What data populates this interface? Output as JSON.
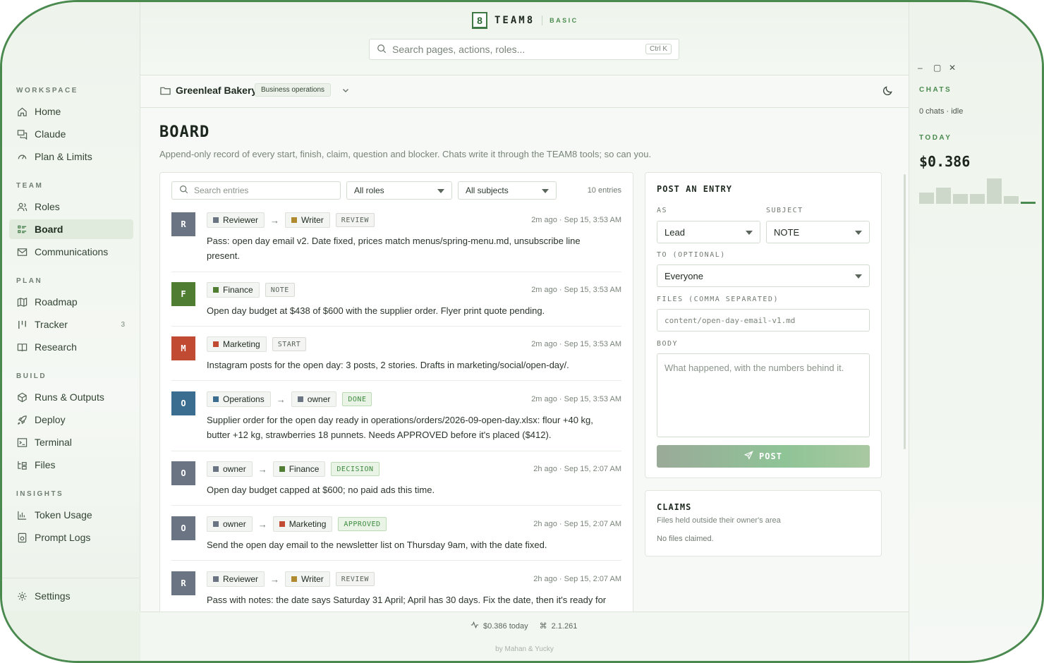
{
  "app": {
    "logo_glyph": "8",
    "name": "TEAM8",
    "plan": "BASIC"
  },
  "search": {
    "placeholder": "Search pages, actions, roles...",
    "shortcut": "Ctrl K"
  },
  "sidebar": {
    "sections": [
      {
        "title": "WORKSPACE"
      },
      {
        "title": "TEAM"
      },
      {
        "title": "PLAN"
      },
      {
        "title": "BUILD"
      },
      {
        "title": "INSIGHTS"
      }
    ],
    "items": [
      {
        "label": "Home",
        "icon": "home-icon"
      },
      {
        "label": "Claude",
        "icon": "chat-icon"
      },
      {
        "label": "Plan & Limits",
        "icon": "gauge-icon"
      },
      {
        "label": "Roles",
        "icon": "users-icon"
      },
      {
        "label": "Board",
        "icon": "board-icon",
        "active": true
      },
      {
        "label": "Communications",
        "icon": "mail-icon"
      },
      {
        "label": "Roadmap",
        "icon": "map-icon"
      },
      {
        "label": "Tracker",
        "icon": "tracker-icon",
        "count": "3"
      },
      {
        "label": "Research",
        "icon": "book-icon"
      },
      {
        "label": "Runs & Outputs",
        "icon": "cube-icon"
      },
      {
        "label": "Deploy",
        "icon": "rocket-icon"
      },
      {
        "label": "Terminal",
        "icon": "terminal-icon"
      },
      {
        "label": "Files",
        "icon": "files-icon"
      },
      {
        "label": "Token Usage",
        "icon": "bar-chart-icon"
      },
      {
        "label": "Prompt Logs",
        "icon": "log-icon"
      }
    ],
    "settings_label": "Settings"
  },
  "breadcrumb": {
    "project": "Greenleaf Bakery",
    "tag": "Business operations"
  },
  "page": {
    "title": "BOARD",
    "subtitle": "Append-only record of every start, finish, claim, question and blocker. Chats write it through the TEAM8 tools; so can you."
  },
  "filters": {
    "search_placeholder": "Search entries",
    "roles_value": "All roles",
    "subjects_value": "All subjects",
    "count": "10 entries"
  },
  "entries": [
    {
      "initial": "R",
      "avatar_color": "#6b7483",
      "from": "Reviewer",
      "from_color": "#6b7483",
      "to": "Writer",
      "to_color": "#b08a2e",
      "type": "REVIEW",
      "type_style": "gray",
      "time": "2m ago · Sep 15, 3:53 AM",
      "body": "Pass: open day email v2. Date fixed, prices match menus/spring-menu.md, unsubscribe line present."
    },
    {
      "initial": "F",
      "avatar_color": "#4f7d32",
      "from": "Finance",
      "from_color": "#4f7d32",
      "to": "",
      "to_color": "",
      "type": "NOTE",
      "type_style": "gray",
      "time": "2m ago · Sep 15, 3:53 AM",
      "body": "Open day budget at $438 of $600 with the supplier order. Flyer print quote pending."
    },
    {
      "initial": "M",
      "avatar_color": "#c04a32",
      "from": "Marketing",
      "from_color": "#c04a32",
      "to": "",
      "to_color": "",
      "type": "START",
      "type_style": "gray",
      "time": "2m ago · Sep 15, 3:53 AM",
      "body": "Instagram posts for the open day: 3 posts, 2 stories. Drafts in marketing/social/open-day/."
    },
    {
      "initial": "O",
      "avatar_color": "#3a6d8f",
      "from": "Operations",
      "from_color": "#3a6d8f",
      "to": "owner",
      "to_color": "#6b7483",
      "type": "DONE",
      "type_style": "green",
      "time": "2m ago · Sep 15, 3:53 AM",
      "body": "Supplier order for the open day ready in operations/orders/2026-09-open-day.xlsx: flour +40 kg, butter +12 kg, strawberries 18 punnets. Needs APPROVED before it's placed ($412)."
    },
    {
      "initial": "O",
      "avatar_color": "#6b7483",
      "from": "owner",
      "from_color": "#6b7483",
      "to": "Finance",
      "to_color": "#4f7d32",
      "type": "DECISION",
      "type_style": "green",
      "time": "2h ago · Sep 15, 2:07 AM",
      "body": "Open day budget capped at $600; no paid ads this time."
    },
    {
      "initial": "O",
      "avatar_color": "#6b7483",
      "from": "owner",
      "from_color": "#6b7483",
      "to": "Marketing",
      "to_color": "#c04a32",
      "type": "APPROVED",
      "type_style": "green",
      "time": "2h ago · Sep 15, 2:07 AM",
      "body": "Send the open day email to the newsletter list on Thursday 9am, with the date fixed."
    },
    {
      "initial": "R",
      "avatar_color": "#6b7483",
      "from": "Reviewer",
      "from_color": "#6b7483",
      "to": "Writer",
      "to_color": "#b08a2e",
      "type": "REVIEW",
      "type_style": "gray",
      "time": "2h ago · Sep 15, 2:07 AM",
      "body": "Pass with notes: the date says Saturday 31 April; April has 30 days. Fix the date, then it's ready for"
    }
  ],
  "post_form": {
    "title": "POST AN ENTRY",
    "as_label": "AS",
    "as_value": "Lead",
    "subject_label": "SUBJECT",
    "subject_value": "NOTE",
    "to_label": "TO (OPTIONAL)",
    "to_value": "Everyone",
    "files_label": "FILES (COMMA SEPARATED)",
    "files_placeholder": "content/open-day-email-v1.md",
    "body_label": "BODY",
    "body_placeholder": "What happened, with the numbers behind it.",
    "post_label": "POST"
  },
  "claims": {
    "title": "CLAIMS",
    "subtitle": "Files held outside their owner's area",
    "empty": "No files claimed."
  },
  "right_panel": {
    "chats_label": "CHATS",
    "chats_status": "0 chats · idle",
    "today_label": "TODAY",
    "today_amount": "$0.386",
    "spark_values": [
      0.45,
      0.65,
      0.4,
      0.4,
      1.0,
      0.3,
      0.1
    ]
  },
  "footer": {
    "cost": "$0.386 today",
    "version": "2.1.261",
    "credit": "by Mahan & Yucky"
  },
  "colors": {
    "accent": "#4a8a4f",
    "active_bg": "#e0ebdd"
  }
}
